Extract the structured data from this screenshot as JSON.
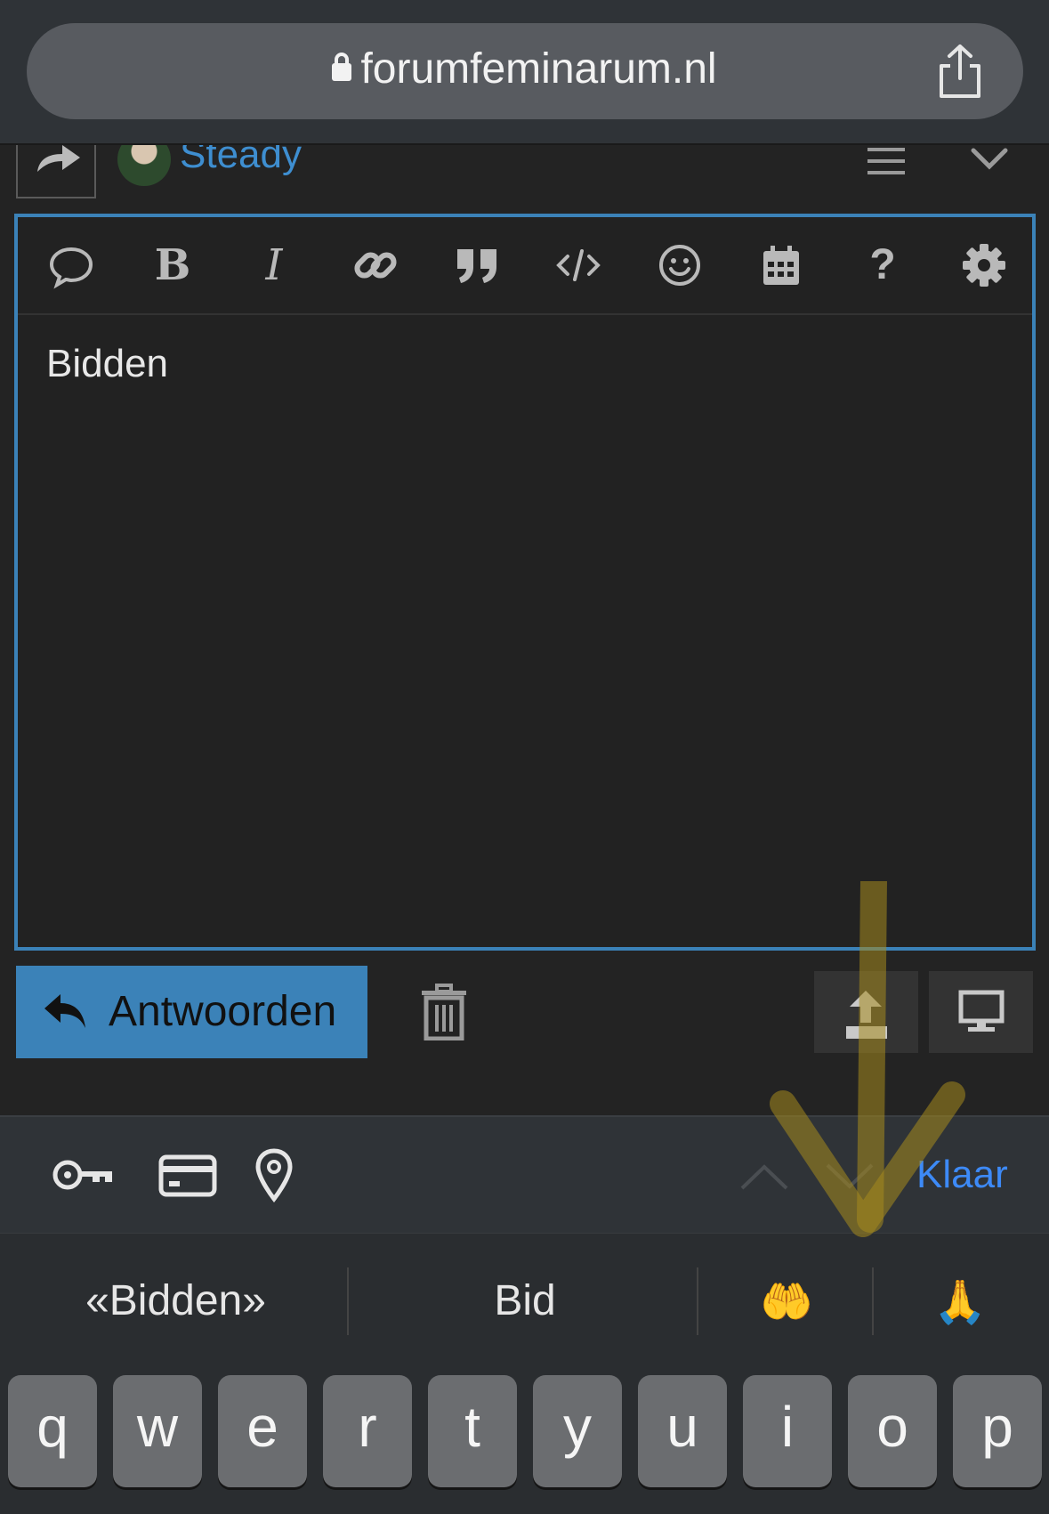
{
  "browser": {
    "url": "forumfeminarum.nl"
  },
  "post_header": {
    "username": "Steady"
  },
  "toolbar": {
    "icons": [
      "speech-bubble-icon",
      "bold-icon",
      "italic-icon",
      "link-icon",
      "quote-icon",
      "code-icon",
      "smiley-icon",
      "calendar-icon",
      "help-icon",
      "gear-icon"
    ],
    "bold_glyph": "B",
    "italic_glyph": "I",
    "help_glyph": "?"
  },
  "editor": {
    "text": "Bidden"
  },
  "actions": {
    "reply_label": "Antwoorden"
  },
  "accessory": {
    "done_label": "Klaar"
  },
  "predictions": {
    "items": [
      "«Bidden»",
      "Bid",
      "🤲",
      "🙏"
    ]
  },
  "keyboard": {
    "row1": [
      "q",
      "w",
      "e",
      "r",
      "t",
      "y",
      "u",
      "i",
      "o",
      "p"
    ]
  },
  "colors": {
    "accent": "#3b82b8",
    "link": "#3e8ed0",
    "done": "#3d8af7",
    "annotation": "#a58a1e"
  }
}
